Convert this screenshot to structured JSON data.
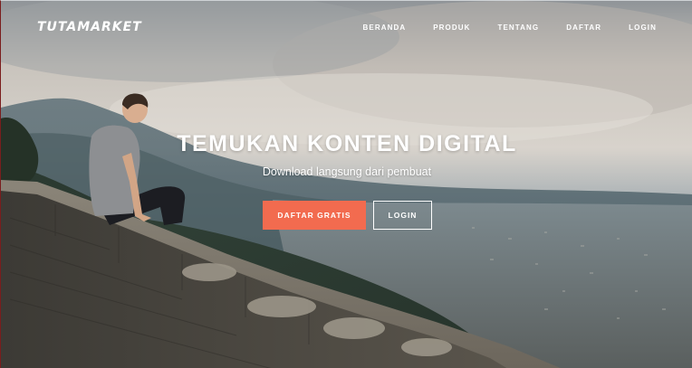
{
  "brand": {
    "logo_text": "TUTAMARKET"
  },
  "nav": {
    "items": [
      {
        "label": "BERANDA"
      },
      {
        "label": "PRODUK"
      },
      {
        "label": "TENTANG"
      },
      {
        "label": "DAFTAR"
      },
      {
        "label": "LOGIN"
      }
    ]
  },
  "hero": {
    "headline": "TEMUKAN KONTEN DIGITAL",
    "subheadline": "Download langsung dari pembuat",
    "primary_button": "DAFTAR GRATIS",
    "secondary_button": "LOGIN"
  },
  "colors": {
    "accent": "#f26b4f",
    "text": "#ffffff"
  }
}
